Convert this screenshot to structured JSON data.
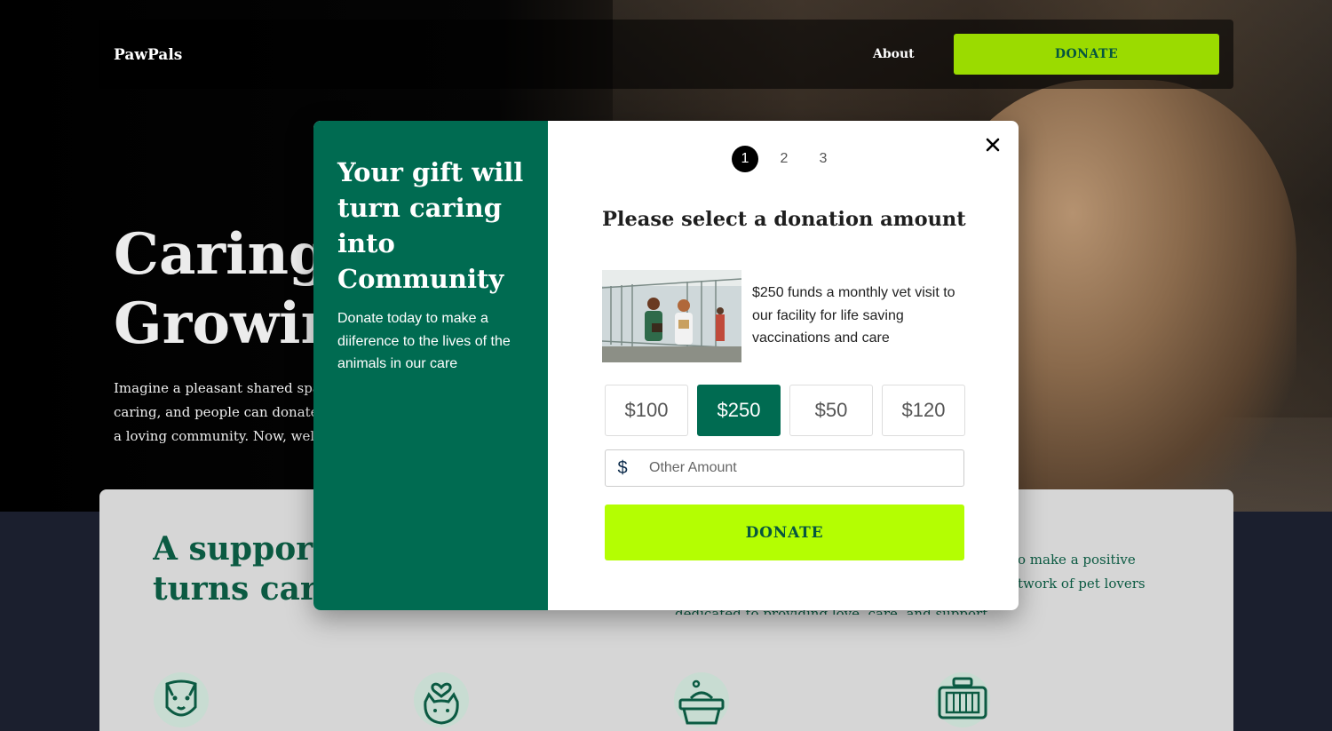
{
  "site": {
    "brand": "PawPals",
    "nav": {
      "about_label": "About",
      "donate_label": "DONATE"
    },
    "hero": {
      "title_line1": "Caring T",
      "title_line2": "Growin",
      "text_line1": "Imagine a pleasant shared spa",
      "text_line2": "caring, and people can donate",
      "text_line3": "a loving community. Now, welc"
    },
    "section": {
      "title_line1": "A supporti",
      "title_line2": "turns carin",
      "text_line1": "o make a positive",
      "text_line2": "twork of pet lovers",
      "text_line3": "dedicated to providing love, care, and support."
    },
    "features": [
      "dog-icon",
      "cat-heart-icon",
      "pet-bed-icon",
      "pet-carrier-icon"
    ]
  },
  "modal": {
    "heading": "Your gift will turn caring into Community",
    "subtext": "Donate today to make a diiference to the lives of the animals in our care",
    "steps": [
      "1",
      "2",
      "3"
    ],
    "active_step": "1",
    "select_title": "Please select a donation amount",
    "promo_text": "$250 funds a monthly vet visit to our facility for life saving vaccinations and care",
    "amounts": [
      "$100",
      "$250",
      "$50",
      "$120"
    ],
    "selected_amount": "$250",
    "currency_symbol": "$",
    "other_placeholder": "Other Amount",
    "donate_label": "DONATE"
  },
  "colors": {
    "brand_green": "#006b51",
    "cta_lime": "#b4fe02",
    "nav_lime": "#9bdb00"
  }
}
